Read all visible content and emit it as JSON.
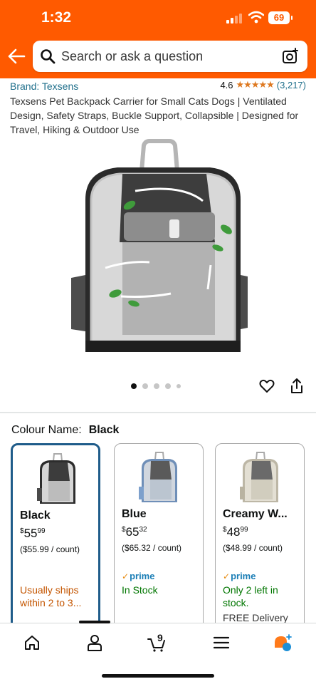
{
  "status": {
    "time": "1:32",
    "battery": "69"
  },
  "search": {
    "placeholder": "Search or ask a question"
  },
  "product": {
    "brand": "Brand: Texsens",
    "rating": "4.6",
    "stars": "★★★★★",
    "review_count": "(3,217)",
    "title": "Texsens Pet Backpack Carrier for Small Cats Dogs | Ventilated Design, Safety Straps, Buckle Support, Collapsible | Designed for Travel, Hiking & Outdoor Use",
    "image_count": 5,
    "image_index": 1
  },
  "colour": {
    "label": "Colour Name:",
    "selected": "Black"
  },
  "options": [
    {
      "name": "Black",
      "currency": "$",
      "price_whole": "55",
      "price_frac": "99",
      "per_unit": "($55.99 / count)",
      "prime": "",
      "availability": "Usually ships within 2 to 3...",
      "delivery": "",
      "selected": true
    },
    {
      "name": "Blue",
      "currency": "$",
      "price_whole": "65",
      "price_frac": "32",
      "per_unit": "($65.32 / count)",
      "prime": "prime",
      "availability": "In Stock",
      "delivery": "",
      "selected": false
    },
    {
      "name": "Creamy W...",
      "currency": "$",
      "price_whole": "48",
      "price_frac": "99",
      "per_unit": "($48.99 / count)",
      "prime": "prime",
      "availability": "Only 2 left in stock.",
      "delivery": "FREE Delivery",
      "selected": false
    }
  ],
  "nav": {
    "cart_count": "9"
  },
  "colors": {
    "header": "#ff5a00",
    "link": "#1f6f8b",
    "selected_border": "#1f5c8a",
    "in_stock": "#007600",
    "ships_later": "#c45500",
    "prime": "#1b7eb6"
  }
}
